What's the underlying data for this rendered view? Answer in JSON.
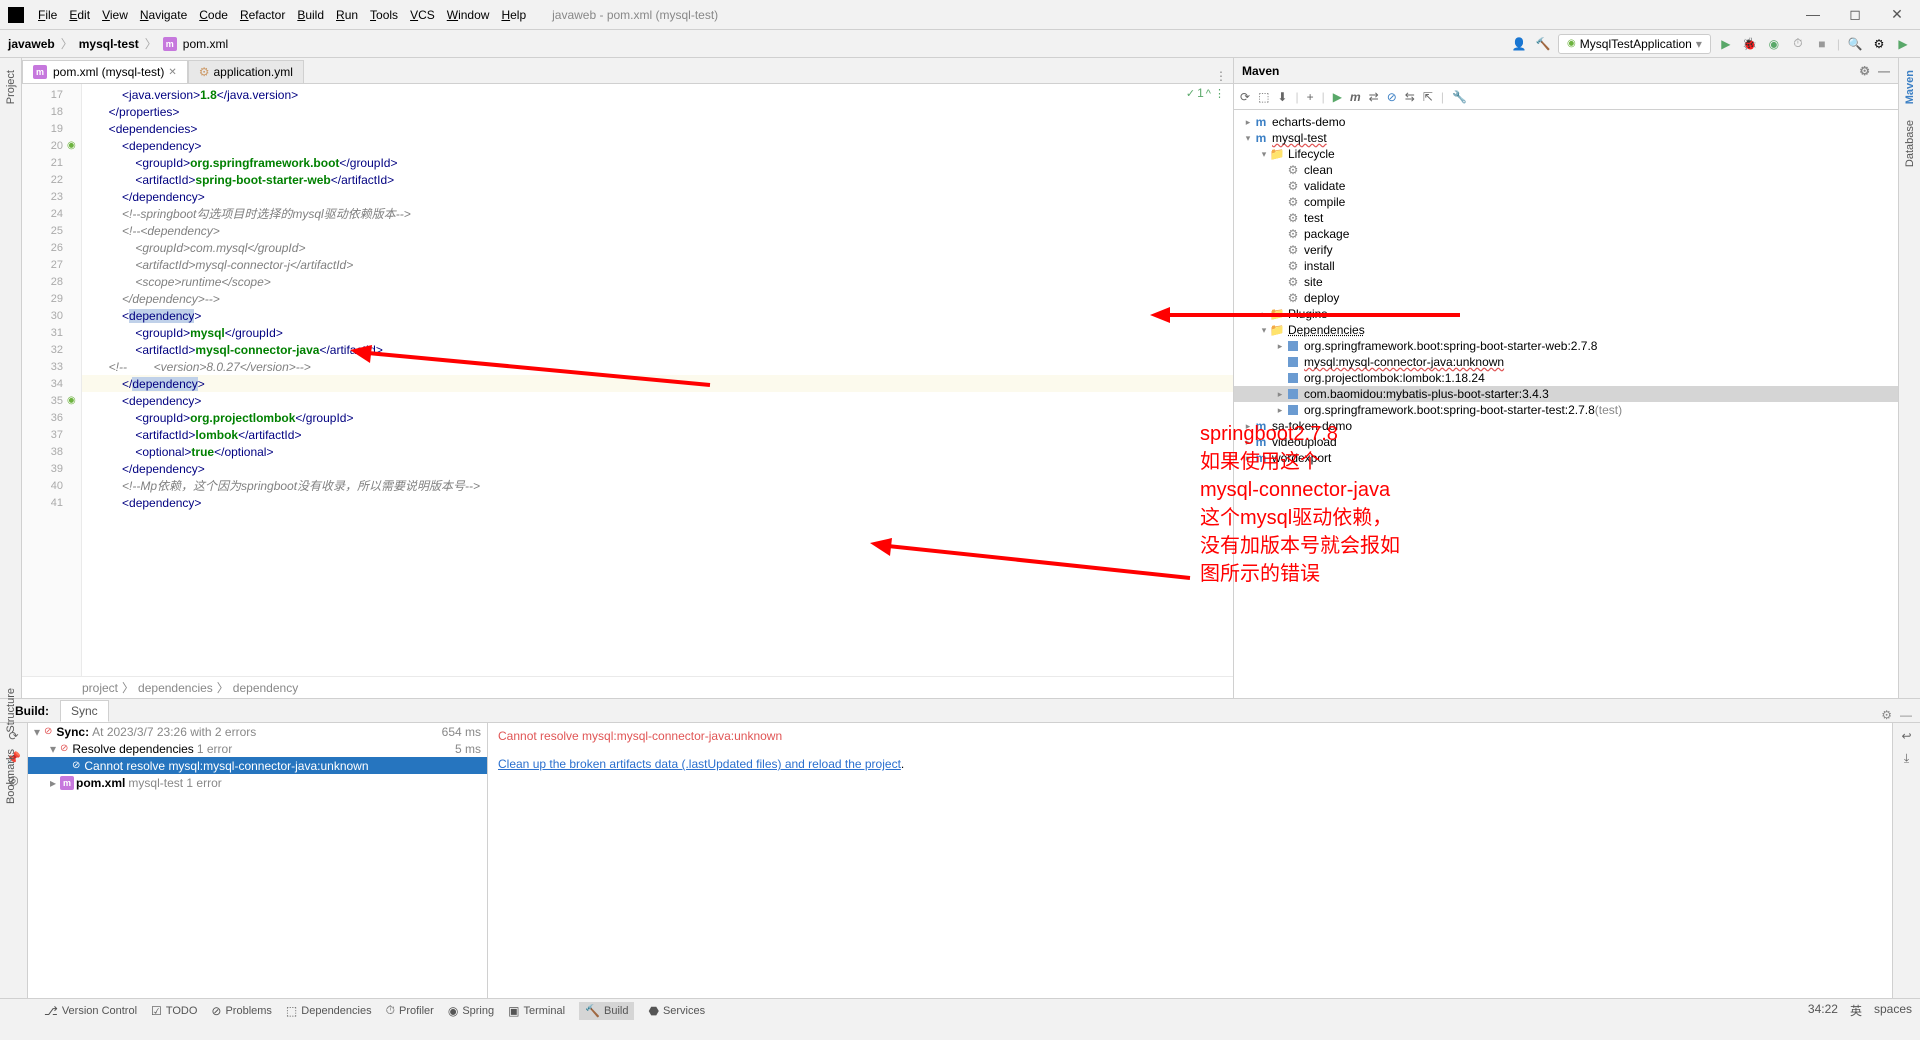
{
  "menu": [
    "File",
    "Edit",
    "View",
    "Navigate",
    "Code",
    "Refactor",
    "Build",
    "Run",
    "Tools",
    "VCS",
    "Window",
    "Help"
  ],
  "title": "javaweb - pom.xml (mysql-test)",
  "breadcrumb": {
    "root": "javaweb",
    "mid": "mysql-test",
    "file": "pom.xml"
  },
  "run_config": "MysqlTestApplication",
  "tabs": {
    "active": "pom.xml (mysql-test)",
    "inactive": "application.yml"
  },
  "code_status": "1",
  "gutter_start": 17,
  "code": [
    {
      "n": 17,
      "pre": "            ",
      "t": [
        [
          "tag",
          "<"
        ],
        [
          "tag",
          "java.version"
        ],
        [
          "tag",
          ">"
        ],
        [
          "text",
          "1.8"
        ],
        [
          "tag",
          "</"
        ],
        [
          "tag",
          "java.version"
        ],
        [
          "tag",
          ">"
        ]
      ]
    },
    {
      "n": 18,
      "pre": "        ",
      "t": [
        [
          "tag",
          "</"
        ],
        [
          "tag",
          "properties"
        ],
        [
          "tag",
          ">"
        ]
      ]
    },
    {
      "n": 19,
      "pre": "        ",
      "t": [
        [
          "tag",
          "<"
        ],
        [
          "tag",
          "dependencies"
        ],
        [
          "tag",
          ">"
        ]
      ]
    },
    {
      "n": 20,
      "pre": "            ",
      "icon": "spring",
      "t": [
        [
          "tag",
          "<"
        ],
        [
          "tag",
          "dependency"
        ],
        [
          "tag",
          ">"
        ]
      ]
    },
    {
      "n": 21,
      "pre": "                ",
      "t": [
        [
          "tag",
          "<"
        ],
        [
          "tag",
          "groupId"
        ],
        [
          "tag",
          ">"
        ],
        [
          "text",
          "org.springframework.boot"
        ],
        [
          "tag",
          "</"
        ],
        [
          "tag",
          "groupId"
        ],
        [
          "tag",
          ">"
        ]
      ]
    },
    {
      "n": 22,
      "pre": "                ",
      "t": [
        [
          "tag",
          "<"
        ],
        [
          "tag",
          "artifactId"
        ],
        [
          "tag",
          ">"
        ],
        [
          "text",
          "spring-boot-starter-web"
        ],
        [
          "tag",
          "</"
        ],
        [
          "tag",
          "artifactId"
        ],
        [
          "tag",
          ">"
        ]
      ]
    },
    {
      "n": 23,
      "pre": "            ",
      "t": [
        [
          "tag",
          "</"
        ],
        [
          "tag",
          "dependency"
        ],
        [
          "tag",
          ">"
        ]
      ]
    },
    {
      "n": 24,
      "pre": "            ",
      "t": [
        [
          "comment",
          "<!--springboot勾选项目时选择的mysql驱动依赖版本-->"
        ]
      ]
    },
    {
      "n": 25,
      "pre": "            ",
      "t": [
        [
          "comment",
          "<!--<dependency>"
        ]
      ]
    },
    {
      "n": 26,
      "pre": "                ",
      "t": [
        [
          "comment",
          "<groupId>com.mysql</groupId>"
        ]
      ]
    },
    {
      "n": 27,
      "pre": "                ",
      "t": [
        [
          "comment",
          "<artifactId>mysql-connector-j</artifactId>"
        ]
      ]
    },
    {
      "n": 28,
      "pre": "                ",
      "t": [
        [
          "comment",
          "<scope>runtime</scope>"
        ]
      ]
    },
    {
      "n": 29,
      "pre": "            ",
      "t": [
        [
          "comment",
          "</dependency>-->"
        ]
      ]
    },
    {
      "n": 30,
      "pre": "            ",
      "t": [
        [
          "tag",
          "<"
        ],
        [
          "hl",
          "dependency"
        ],
        [
          "tag",
          ">"
        ]
      ]
    },
    {
      "n": 31,
      "pre": "                ",
      "t": [
        [
          "tag",
          "<"
        ],
        [
          "tag",
          "groupId"
        ],
        [
          "tag",
          ">"
        ],
        [
          "text",
          "mysql"
        ],
        [
          "tag",
          "</"
        ],
        [
          "tag",
          "groupId"
        ],
        [
          "tag",
          ">"
        ]
      ]
    },
    {
      "n": 32,
      "pre": "                ",
      "t": [
        [
          "tag",
          "<"
        ],
        [
          "tag",
          "artifactId"
        ],
        [
          "tag",
          ">"
        ],
        [
          "text",
          "mysql-connector-java"
        ],
        [
          "tag",
          "</"
        ],
        [
          "tag",
          "artifactId"
        ],
        [
          "tag",
          ">"
        ]
      ]
    },
    {
      "n": 33,
      "pre": "        ",
      "t": [
        [
          "comment",
          "<!--        <version>8.0.27</version>-->"
        ]
      ]
    },
    {
      "n": 34,
      "pre": "            ",
      "caret": true,
      "t": [
        [
          "tag",
          "</"
        ],
        [
          "hl",
          "dependency"
        ],
        [
          "tag",
          ">"
        ]
      ]
    },
    {
      "n": 35,
      "pre": "            ",
      "icon": "spring",
      "t": [
        [
          "tag",
          "<"
        ],
        [
          "tag",
          "dependency"
        ],
        [
          "tag",
          ">"
        ]
      ]
    },
    {
      "n": 36,
      "pre": "                ",
      "t": [
        [
          "tag",
          "<"
        ],
        [
          "tag",
          "groupId"
        ],
        [
          "tag",
          ">"
        ],
        [
          "text",
          "org.projectlombok"
        ],
        [
          "tag",
          "</"
        ],
        [
          "tag",
          "groupId"
        ],
        [
          "tag",
          ">"
        ]
      ]
    },
    {
      "n": 37,
      "pre": "                ",
      "t": [
        [
          "tag",
          "<"
        ],
        [
          "tag",
          "artifactId"
        ],
        [
          "tag",
          ">"
        ],
        [
          "text",
          "lombok"
        ],
        [
          "tag",
          "</"
        ],
        [
          "tag",
          "artifactId"
        ],
        [
          "tag",
          ">"
        ]
      ]
    },
    {
      "n": 38,
      "pre": "                ",
      "t": [
        [
          "tag",
          "<"
        ],
        [
          "tag",
          "optional"
        ],
        [
          "tag",
          ">"
        ],
        [
          "text",
          "true"
        ],
        [
          "tag",
          "</"
        ],
        [
          "tag",
          "optional"
        ],
        [
          "tag",
          ">"
        ]
      ]
    },
    {
      "n": 39,
      "pre": "            ",
      "t": [
        [
          "tag",
          "</"
        ],
        [
          "tag",
          "dependency"
        ],
        [
          "tag",
          ">"
        ]
      ]
    },
    {
      "n": 40,
      "pre": "            ",
      "t": [
        [
          "comment",
          "<!--Mp依赖，这个因为springboot没有收录，所以需要说明版本号-->"
        ]
      ]
    },
    {
      "n": 41,
      "pre": "            ",
      "t": [
        [
          "tag",
          "<"
        ],
        [
          "tag",
          "dependency"
        ],
        [
          "tag",
          ">"
        ]
      ]
    }
  ],
  "crumbs": [
    "project",
    "dependencies",
    "dependency"
  ],
  "maven": {
    "title": "Maven",
    "projects": [
      "echarts-demo"
    ],
    "active": "mysql-test",
    "lifecycle": [
      "clean",
      "validate",
      "compile",
      "test",
      "package",
      "verify",
      "install",
      "site",
      "deploy"
    ],
    "deps": [
      {
        "t": "org.springframework.boot:spring-boot-starter-web:2.7.8",
        "exp": true
      },
      {
        "t": "mysql:mysql-connector-java:unknown",
        "err": true
      },
      {
        "t": "org.projectlombok:lombok:1.18.24"
      },
      {
        "t": "com.baomidou:mybatis-plus-boot-starter:3.4.3",
        "exp": true,
        "sel": true
      },
      {
        "t": "org.springframework.boot:spring-boot-starter-test:2.7.8",
        "suffix": " (test)",
        "exp": true
      }
    ],
    "other": [
      "sa-token-demo",
      "videoupload",
      "wordexport"
    ]
  },
  "build": {
    "tab_build": "Build:",
    "tab_sync": "Sync",
    "sync_line": {
      "label": "Sync:",
      "detail": "At 2023/3/7 23:26 with 2 errors",
      "time": "654 ms"
    },
    "resolve_line": {
      "label": "Resolve dependencies",
      "detail": "1 error",
      "time": "5 ms"
    },
    "error_line": "Cannot resolve mysql:mysql-connector-java:unknown",
    "pom_line": {
      "label": "pom.xml",
      "detail": "mysql-test 1 error"
    },
    "output_err": "Cannot resolve mysql:mysql-connector-java:unknown",
    "output_link": "Clean up the broken artifacts data (.lastUpdated files) and reload the project"
  },
  "bottom": [
    "Version Control",
    "TODO",
    "Problems",
    "Dependencies",
    "Profiler",
    "Spring",
    "Terminal",
    "Build",
    "Services"
  ],
  "status": {
    "pos": "34:22",
    "enc": "英",
    "sp": "spaces"
  },
  "annotation": "springboot2.7.8\n如果使用这个\nmysql-connector-java\n这个mysql驱动依赖，\n没有加版本号就会报如\n图所示的错误",
  "right_tabs": [
    "Maven",
    "Database"
  ],
  "left_tabs": [
    "Project"
  ],
  "left_tabs2": [
    "Bookmarks",
    "Structure"
  ]
}
